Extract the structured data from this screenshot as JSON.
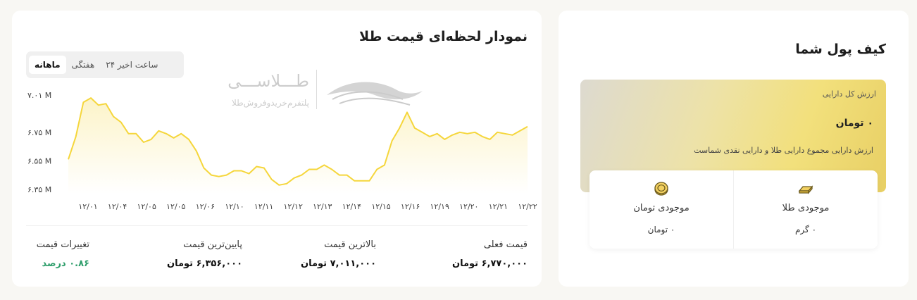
{
  "wallet": {
    "title": "کیف پول شما",
    "total_label": "ارزش کل دارایی",
    "total_value": "۰ تومان",
    "total_desc": "ارزش دارایی مجموع دارایی طلا و دارایی نقدی شماست",
    "gold_title": "موجودی طلا",
    "gold_value": "۰ گرم",
    "toman_title": "موجودی تومان",
    "toman_value": "۰ تومان"
  },
  "chart_panel": {
    "title": "نمودار لحظه‌ای قیمت طلا",
    "tabs": [
      {
        "label": "۲۴ ساعت اخیر"
      },
      {
        "label": "هفتگی"
      },
      {
        "label": "ماهانه"
      }
    ],
    "brand_name": "طـــلاســـی",
    "brand_sub": "پلتفرم‌خریدوفروش‌طلا",
    "stats": {
      "current_label": "قیمت فعلی",
      "current_value": "۶,۷۷۰,۰۰۰ تومان",
      "high_label": "بالاترین قیمت",
      "high_value": "۷,۰۱۱,۰۰۰ تومان",
      "low_label": "پایین‌ترین قیمت",
      "low_value": "۶,۳۵۶,۰۰۰ تومان",
      "change_label": "تغییرات قیمت",
      "change_value": "۰.۸۶ درصد"
    }
  },
  "colors": {
    "line": "#f5d63b",
    "accent_green": "#2e9e6b"
  },
  "chart_data": {
    "type": "area",
    "y_tick_labels": [
      "۷.۰۱ M",
      "۶.۷۵ M",
      "۶.۵۵ M",
      "۶.۳۵ M"
    ],
    "y_tick_values": [
      7.01,
      6.75,
      6.55,
      6.35
    ],
    "ylim": [
      6.32,
      7.03
    ],
    "x_tick_labels": [
      "۱۲/۰۱",
      "۱۲/۰۴",
      "۱۲/۰۵",
      "۱۲/۰۵",
      "۱۲/۰۶",
      "۱۲/۱۰",
      "۱۲/۱۱",
      "۱۲/۱۲",
      "۱۲/۱۳",
      "۱۲/۱۴",
      "۱۲/۱۵",
      "۱۲/۱۶",
      "۱۲/۱۹",
      "۱۲/۲۰",
      "۱۲/۲۱",
      "۱۲/۲۲"
    ],
    "values": [
      6.56,
      6.72,
      6.96,
      6.99,
      6.94,
      6.95,
      6.86,
      6.82,
      6.74,
      6.74,
      6.68,
      6.7,
      6.76,
      6.74,
      6.71,
      6.74,
      6.7,
      6.62,
      6.5,
      6.45,
      6.44,
      6.45,
      6.48,
      6.48,
      6.46,
      6.51,
      6.5,
      6.42,
      6.38,
      6.39,
      6.43,
      6.45,
      6.49,
      6.49,
      6.52,
      6.49,
      6.45,
      6.45,
      6.41,
      6.41,
      6.41,
      6.49,
      6.52,
      6.69,
      6.78,
      6.89,
      6.78,
      6.75,
      6.72,
      6.74,
      6.7,
      6.73,
      6.75,
      6.74,
      6.75,
      6.72,
      6.7,
      6.75,
      6.74,
      6.73,
      6.76,
      6.79
    ]
  }
}
